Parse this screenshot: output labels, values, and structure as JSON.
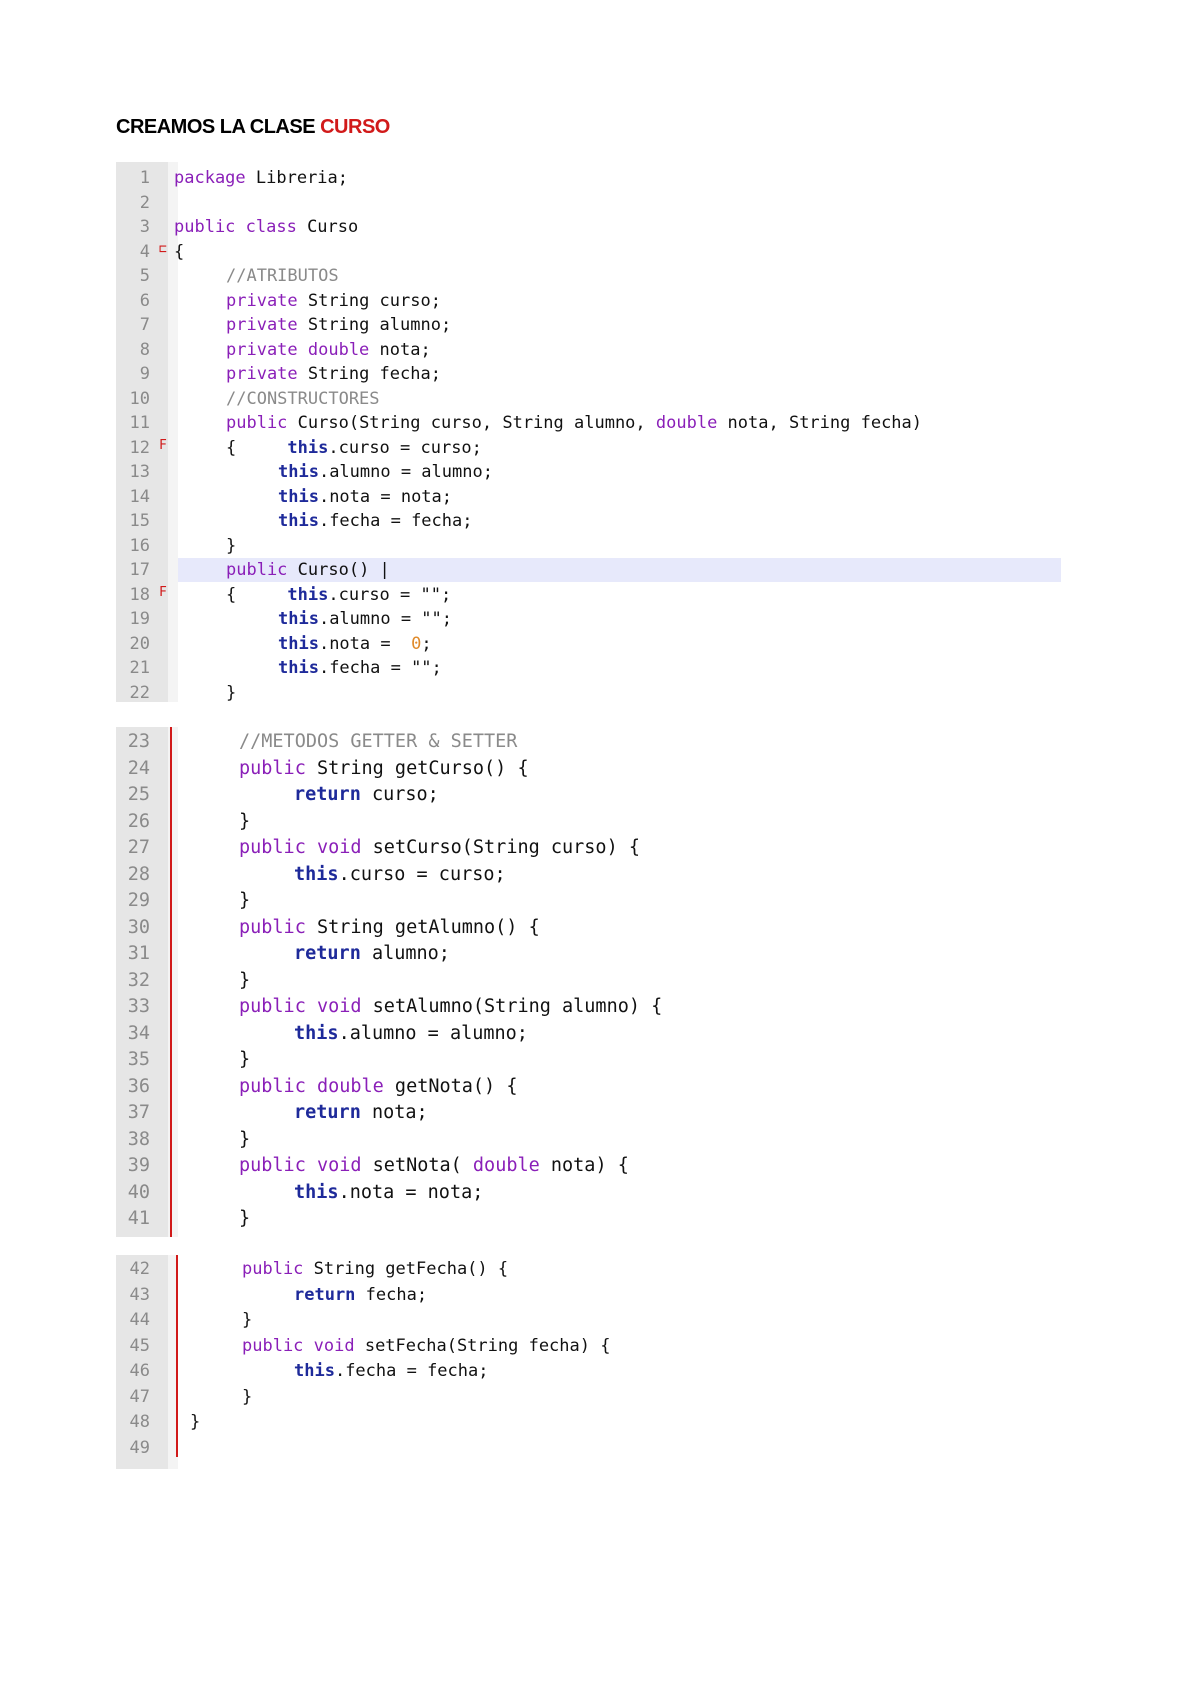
{
  "heading": {
    "prefix": "CREAMOS LA CLASE ",
    "accent": "CURSO"
  },
  "colors": {
    "accent": "#d11a1a",
    "keyword": "#8a1fb8",
    "bold_keyword": "#1e2a9a",
    "comment": "#8a8a8a",
    "number": "#e08a2a",
    "highlight": "#e7e9fb"
  },
  "blocks": [
    {
      "lines": [
        {
          "n": "1",
          "segs": [
            [
              "kw",
              "package"
            ],
            [
              "",
              "Libreria;"
            ]
          ]
        },
        {
          "n": "2",
          "segs": []
        },
        {
          "n": "3",
          "segs": [
            [
              "kw",
              "public class"
            ],
            [
              "",
              "Curso"
            ]
          ]
        },
        {
          "n": "4",
          "segs": [
            [
              "",
              "{"
            ]
          ]
        },
        {
          "n": "5",
          "segs": [
            [
              "cm",
              "//ATRIBUTOS"
            ]
          ]
        },
        {
          "n": "6",
          "segs": [
            [
              "kw",
              "private"
            ],
            [
              "",
              "String curso;"
            ]
          ]
        },
        {
          "n": "7",
          "segs": [
            [
              "kw",
              "private"
            ],
            [
              "",
              "String alumno;"
            ]
          ]
        },
        {
          "n": "8",
          "segs": [
            [
              "kw",
              "private double"
            ],
            [
              "",
              "nota;"
            ]
          ]
        },
        {
          "n": "9",
          "segs": [
            [
              "kw",
              "private"
            ],
            [
              "",
              "String fecha;"
            ]
          ]
        },
        {
          "n": "10",
          "segs": [
            [
              "cm",
              "//CONSTRUCTORES"
            ]
          ]
        },
        {
          "n": "11",
          "segs": [
            [
              "kw",
              "public"
            ],
            [
              "",
              "Curso(String curso, String alumno,"
            ],
            [
              "kw",
              "double"
            ],
            [
              "",
              "nota, String fecha)"
            ]
          ]
        },
        {
          "n": "12",
          "segs": [
            [
              "",
              "{    "
            ],
            [
              "kwb",
              "this"
            ],
            [
              "",
              ".curso = curso;"
            ]
          ]
        },
        {
          "n": "13",
          "segs": [
            [
              "kwb",
              "this"
            ],
            [
              "",
              ".alumno = alumno;"
            ]
          ]
        },
        {
          "n": "14",
          "segs": [
            [
              "kwb",
              "this"
            ],
            [
              "",
              ".nota = nota;"
            ]
          ]
        },
        {
          "n": "15",
          "segs": [
            [
              "kwb",
              "this"
            ],
            [
              "",
              ".fecha = fecha;"
            ]
          ]
        },
        {
          "n": "16",
          "segs": [
            [
              "",
              "}"
            ]
          ]
        },
        {
          "n": "17",
          "segs": [
            [
              "kw",
              "public"
            ],
            [
              "",
              "Curso() |"
            ]
          ]
        },
        {
          "n": "18",
          "segs": [
            [
              "",
              "{    "
            ],
            [
              "kwb",
              "this"
            ],
            [
              "",
              ".curso = \"\";"
            ]
          ]
        },
        {
          "n": "19",
          "segs": [
            [
              "kwb",
              "this"
            ],
            [
              "",
              ".alumno = \"\";"
            ]
          ]
        },
        {
          "n": "20",
          "segs": [
            [
              "kwb",
              "this"
            ],
            [
              "",
              ".nota = "
            ],
            [
              "num",
              "0"
            ],
            [
              "",
              ";"
            ]
          ]
        },
        {
          "n": "21",
          "segs": [
            [
              "kwb",
              "this"
            ],
            [
              "",
              ".fecha = \"\";"
            ]
          ]
        },
        {
          "n": "22",
          "segs": [
            [
              "",
              "}"
            ]
          ]
        }
      ]
    },
    {
      "lines": [
        {
          "n": "23",
          "segs": [
            [
              "cm",
              "//METODOS GETTER & SETTER"
            ]
          ]
        },
        {
          "n": "24",
          "segs": [
            [
              "kw",
              "public"
            ],
            [
              "",
              "String getCurso() {"
            ]
          ]
        },
        {
          "n": "25",
          "segs": [
            [
              "kwb",
              "return"
            ],
            [
              "",
              "curso;"
            ]
          ]
        },
        {
          "n": "26",
          "segs": [
            [
              "",
              "}"
            ]
          ]
        },
        {
          "n": "27",
          "segs": [
            [
              "kw",
              "public void"
            ],
            [
              "",
              "setCurso(String curso) {"
            ]
          ]
        },
        {
          "n": "28",
          "segs": [
            [
              "kwb",
              "this"
            ],
            [
              "",
              ".curso = curso;"
            ]
          ]
        },
        {
          "n": "29",
          "segs": [
            [
              "",
              "}"
            ]
          ]
        },
        {
          "n": "30",
          "segs": [
            [
              "kw",
              "public"
            ],
            [
              "",
              "String getAlumno() {"
            ]
          ]
        },
        {
          "n": "31",
          "segs": [
            [
              "kwb",
              "return"
            ],
            [
              "",
              "alumno;"
            ]
          ]
        },
        {
          "n": "32",
          "segs": [
            [
              "",
              "}"
            ]
          ]
        },
        {
          "n": "33",
          "segs": [
            [
              "kw",
              "public void"
            ],
            [
              "",
              "setAlumno(String alumno) {"
            ]
          ]
        },
        {
          "n": "34",
          "segs": [
            [
              "kwb",
              "this"
            ],
            [
              "",
              ".alumno = alumno;"
            ]
          ]
        },
        {
          "n": "35",
          "segs": [
            [
              "",
              "}"
            ]
          ]
        },
        {
          "n": "36",
          "segs": [
            [
              "kw",
              "public double"
            ],
            [
              "",
              "getNota() {"
            ]
          ]
        },
        {
          "n": "37",
          "segs": [
            [
              "kwb",
              "return"
            ],
            [
              "",
              "nota;"
            ]
          ]
        },
        {
          "n": "38",
          "segs": [
            [
              "",
              "}"
            ]
          ]
        },
        {
          "n": "39",
          "segs": [
            [
              "kw",
              "public void"
            ],
            [
              "",
              "setNota("
            ],
            [
              "kw",
              "double"
            ],
            [
              "",
              "nota) {"
            ]
          ]
        },
        {
          "n": "40",
          "segs": [
            [
              "kwb",
              "this"
            ],
            [
              "",
              ".nota = nota;"
            ]
          ]
        },
        {
          "n": "41",
          "segs": [
            [
              "",
              "}"
            ]
          ]
        }
      ]
    },
    {
      "lines": [
        {
          "n": "42",
          "segs": [
            [
              "kw",
              "public"
            ],
            [
              "",
              "String getFecha() {"
            ]
          ]
        },
        {
          "n": "43",
          "segs": [
            [
              "kwb",
              "return"
            ],
            [
              "",
              "fecha;"
            ]
          ]
        },
        {
          "n": "44",
          "segs": [
            [
              "",
              "}"
            ]
          ]
        },
        {
          "n": "45",
          "segs": [
            [
              "kw",
              "public void"
            ],
            [
              "",
              "setFecha(String fecha) {"
            ]
          ]
        },
        {
          "n": "46",
          "segs": [
            [
              "kwb",
              "this"
            ],
            [
              "",
              ".fecha = fecha;"
            ]
          ]
        },
        {
          "n": "47",
          "segs": [
            [
              "",
              "}"
            ]
          ]
        },
        {
          "n": "48",
          "segs": [
            [
              "",
              "}"
            ]
          ]
        },
        {
          "n": "49",
          "segs": []
        }
      ]
    }
  ]
}
